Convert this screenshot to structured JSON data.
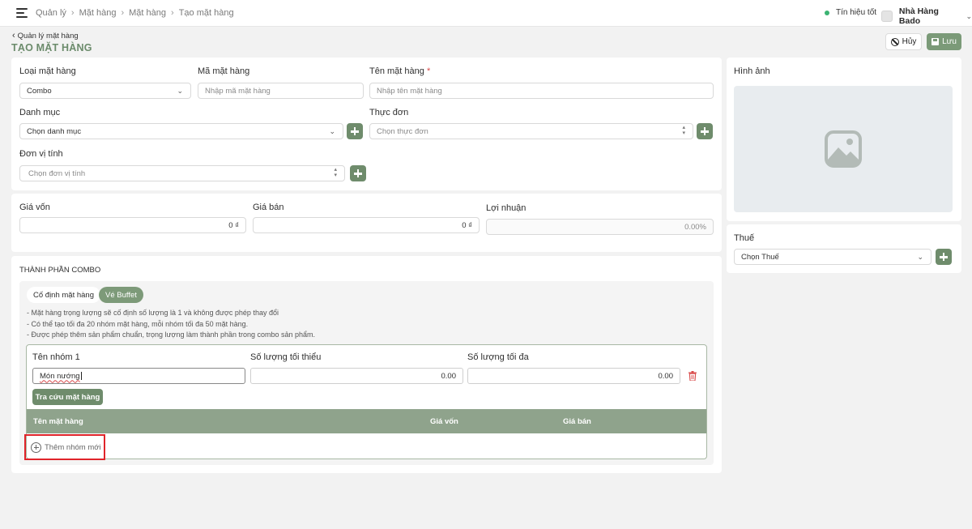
{
  "topbar": {
    "breadcrumbs": [
      "Quản lý",
      "Mặt hàng",
      "Mặt hàng",
      "Tạo mặt hàng"
    ],
    "signal_label": "Tín hiệu tốt",
    "store_name": "Nhà Hàng Bado"
  },
  "header": {
    "back_label": "Quản lý mặt hàng",
    "title": "TẠO MẶT HÀNG",
    "cancel_label": "Hủy",
    "save_label": "Lưu"
  },
  "basic_info": {
    "type_label": "Loại mặt hàng",
    "type_value": "Combo",
    "code_label": "Mã mặt hàng",
    "code_placeholder": "Nhập mã mặt hàng",
    "name_label": "Tên mặt hàng",
    "name_required_mark": "*",
    "name_placeholder": "Nhập tên mặt hàng",
    "category_label": "Danh mục",
    "category_placeholder": "Chọn danh mục",
    "menu_label": "Thực đơn",
    "menu_placeholder": "Chọn thực đơn",
    "unit_label": "Đơn vị tính",
    "unit_placeholder": "Chọn đơn vị tính"
  },
  "pricing": {
    "cost_label": "Giá vốn",
    "cost_value": "0 ₫",
    "price_label": "Giá bán",
    "price_value": "0 ₫",
    "profit_label": "Lợi nhuận",
    "profit_value": "0.00%"
  },
  "combo": {
    "section_title": "THÀNH PHẦN COMBO",
    "tab_fixed": "Cố định mặt hàng",
    "tab_buffet": "Vé Buffet",
    "notes": [
      "- Mặt hàng trọng lượng sẽ cố định số lượng là 1 và không được phép thay đổi",
      "- Có thể tạo tối đa 20 nhóm mặt hàng, mỗi nhóm tối đa 50 mặt hàng.",
      "- Được phép thêm sản phẩm chuẩn, trọng lượng làm thành phần trong combo sản phẩm."
    ],
    "group": {
      "name_label": "Tên nhóm 1",
      "name_value": "Món nướng",
      "min_label": "Số lượng tối thiểu",
      "min_value": "0.00",
      "max_label": "Số lượng tối đa",
      "max_value": "0.00",
      "lookup_button": "Tra cứu mặt hàng",
      "columns": [
        "Tên mặt hàng",
        "Giá vốn",
        "Giá bán"
      ]
    },
    "add_group_label": "Thêm nhóm mới"
  },
  "sidebar": {
    "image_label": "Hình ảnh",
    "tax_label": "Thuế",
    "tax_placeholder": "Chọn Thuế"
  },
  "colors": {
    "accent": "#6f8c6c",
    "table_header": "#8fa38c",
    "highlight": "#e0242a",
    "status_ok": "#3bb372"
  }
}
